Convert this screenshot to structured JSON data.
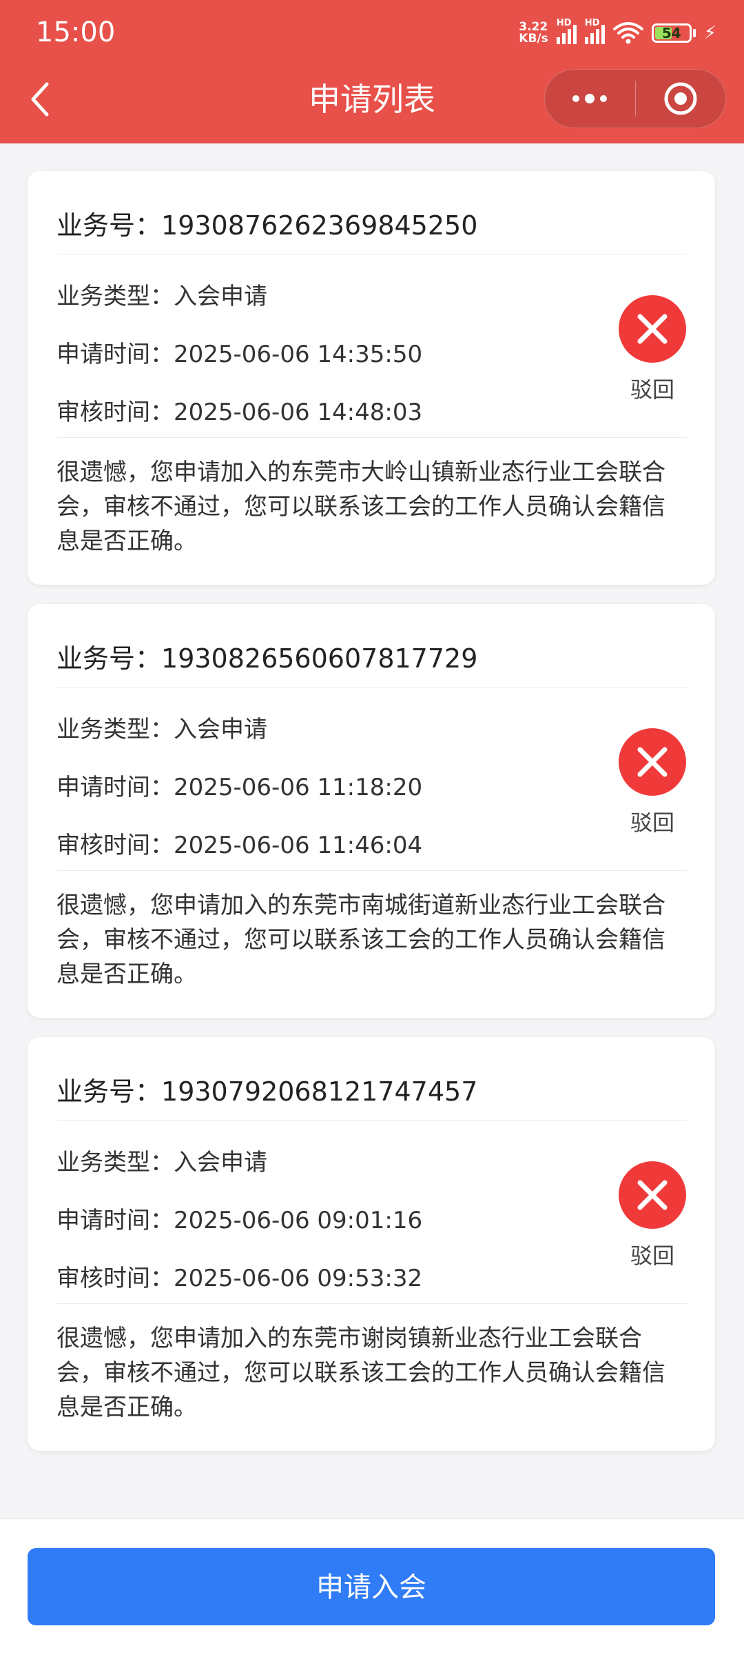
{
  "status_bar": {
    "time": "15:00",
    "net_speed_value": "3.22",
    "net_speed_unit": "KB/s",
    "hd_label_1": "HD",
    "hd_label_2": "HD",
    "battery_level": "54",
    "battery_fraction": 0.54,
    "battery_color": "#9be15d"
  },
  "header": {
    "title": "申请列表",
    "back_icon": "chevron-left-icon",
    "more_icon": "more-dots-icon",
    "close_icon": "target-circle-icon",
    "background_color": "#e8504a"
  },
  "cards": [
    {
      "id_label": "业务号：",
      "id_value": "1930876262369845250",
      "type_label": "业务类型：",
      "type_value": "入会申请",
      "apply_time_label": "申请时间：",
      "apply_time_value": "2025-06-06 14:35:50",
      "review_time_label": "审核时间：",
      "review_time_value": "2025-06-06 14:48:03",
      "status_label": "驳回",
      "status_icon": "reject-x-icon",
      "message": "很遗憾，您申请加入的东莞市大岭山镇新业态行业工会联合会，审核不通过，您可以联系该工会的工作人员确认会籍信息是否正确。"
    },
    {
      "id_label": "业务号：",
      "id_value": "1930826560607817729",
      "type_label": "业务类型：",
      "type_value": "入会申请",
      "apply_time_label": "申请时间：",
      "apply_time_value": "2025-06-06 11:18:20",
      "review_time_label": "审核时间：",
      "review_time_value": "2025-06-06 11:46:04",
      "status_label": "驳回",
      "status_icon": "reject-x-icon",
      "message": "很遗憾，您申请加入的东莞市南城街道新业态行业工会联合会，审核不通过，您可以联系该工会的工作人员确认会籍信息是否正确。"
    },
    {
      "id_label": "业务号：",
      "id_value": "1930792068121747457",
      "type_label": "业务类型：",
      "type_value": "入会申请",
      "apply_time_label": "申请时间：",
      "apply_time_value": "2025-06-06 09:01:16",
      "review_time_label": "审核时间：",
      "review_time_value": "2025-06-06 09:53:32",
      "status_label": "驳回",
      "status_icon": "reject-x-icon",
      "message": "很遗憾，您申请加入的东莞市谢岗镇新业态行业工会联合会，审核不通过，您可以联系该工会的工作人员确认会籍信息是否正确。"
    }
  ],
  "footer": {
    "apply_button_label": "申请入会",
    "button_color": "#2f7cf6"
  },
  "colors": {
    "reject_red": "#f03a3a",
    "page_background": "#f5f5f7"
  }
}
